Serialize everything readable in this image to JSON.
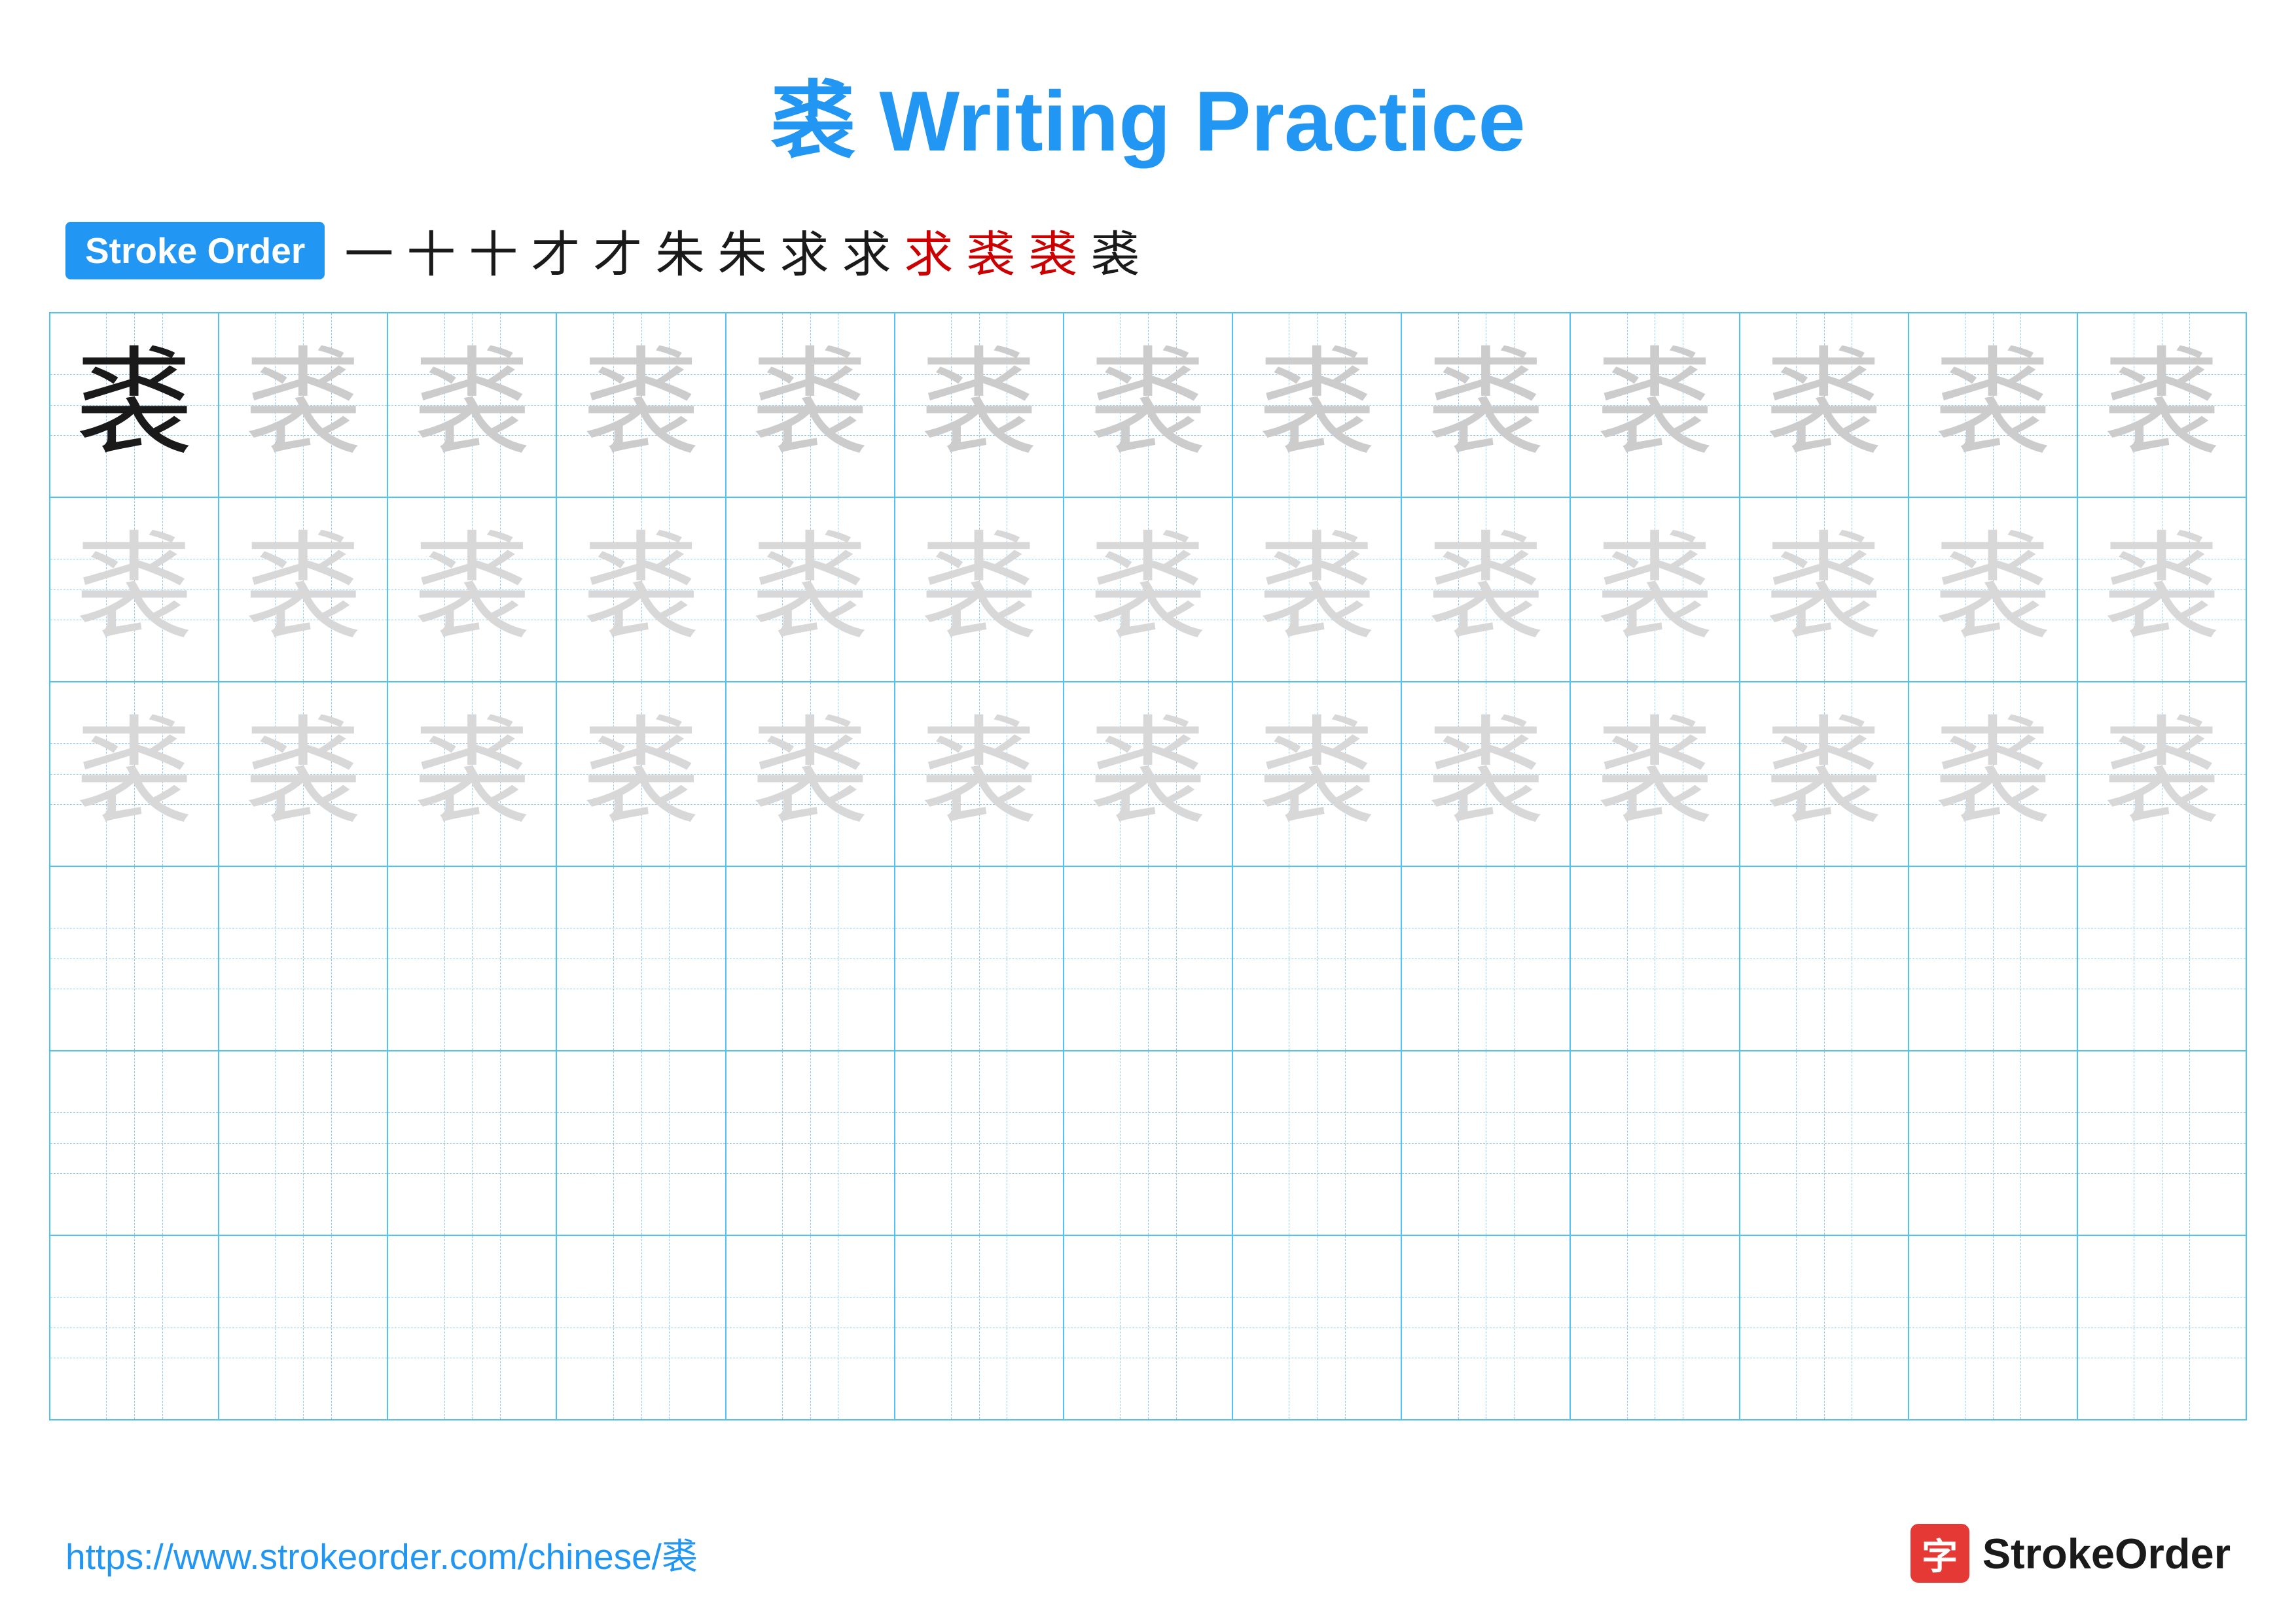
{
  "title": {
    "char": "裘",
    "rest": " Writing Practice",
    "full": "裘 Writing Practice"
  },
  "stroke_order": {
    "badge_label": "Stroke Order",
    "strokes": [
      "一",
      "十",
      "十",
      "才",
      "才",
      "朱",
      "朱",
      "求",
      "求",
      "求",
      "裘",
      "裘",
      "裘"
    ]
  },
  "grid": {
    "char": "裘",
    "rows": 6,
    "cols": 13
  },
  "footer": {
    "url": "https://www.strokeorder.com/chinese/裘",
    "brand_name": "StrokeOrder",
    "brand_icon_char": "字"
  }
}
